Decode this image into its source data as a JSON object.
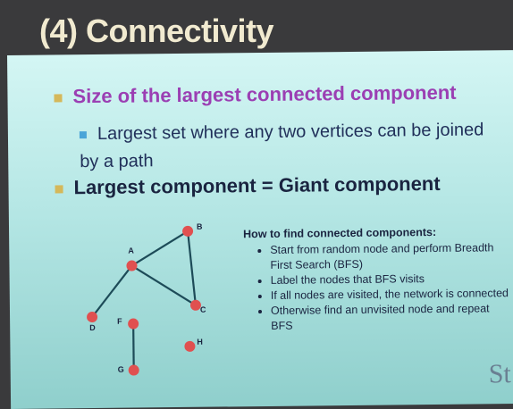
{
  "title": "(4) Connectivity",
  "bullets": {
    "main1": "Size of the largest connected component",
    "sub1": "Largest set where any two vertices can be joined by a path",
    "main2": "Largest component = Giant component"
  },
  "how": {
    "heading": "How to find connected components:",
    "items": [
      "Start from random node and perform Breadth First Search (BFS)",
      "Label the nodes that BFS visits",
      "If all nodes are visited, the network is connected",
      "Otherwise find an unvisited node and repeat BFS"
    ]
  },
  "graph": {
    "nodes": [
      "A",
      "B",
      "C",
      "D",
      "F",
      "G",
      "H"
    ],
    "edges": [
      [
        "A",
        "B"
      ],
      [
        "A",
        "C"
      ],
      [
        "B",
        "C"
      ],
      [
        "A",
        "D"
      ],
      [
        "F",
        "G"
      ]
    ],
    "node_color": "#e05050",
    "edge_color": "#1d4b58"
  },
  "logo": "St"
}
